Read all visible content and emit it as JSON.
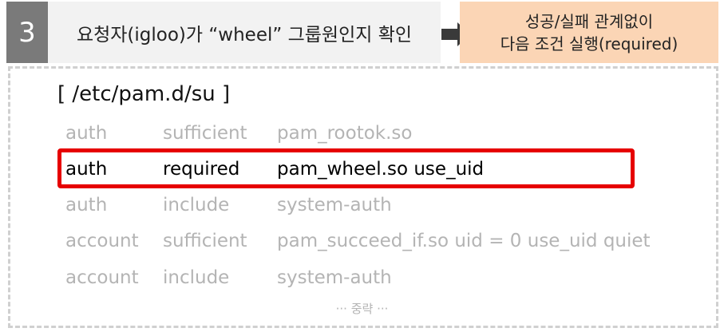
{
  "header": {
    "step_number": "3",
    "step_title": "요청자(igloo)가 “wheel” 그룹원인지 확인",
    "result_line1": "성공/실패 관계없이",
    "result_line2": "다음 조건 실행(required)"
  },
  "file": {
    "title": "[ /etc/pam.d/su ]",
    "rows": [
      {
        "type": "auth",
        "control": "sufficient",
        "module": "pam_rootok.so"
      },
      {
        "type": "auth",
        "control": "required",
        "module": "pam_wheel.so use_uid"
      },
      {
        "type": "auth",
        "control": "include",
        "module": "system-auth"
      },
      {
        "type": "account",
        "control": "sufficient",
        "module": "pam_succeed_if.so uid = 0 use_uid quiet"
      },
      {
        "type": "account",
        "control": "include",
        "module": "system-auth"
      }
    ],
    "ellipsis": "··· 중략 ···"
  },
  "colors": {
    "step_bg": "#7a7a7a",
    "title_bg": "#f2f2f2",
    "result_bg": "#fbd5b5",
    "highlight": "#e60000",
    "dim_text": "#b4b4b4"
  },
  "icons": {
    "arrow": "arrow-right-icon"
  }
}
